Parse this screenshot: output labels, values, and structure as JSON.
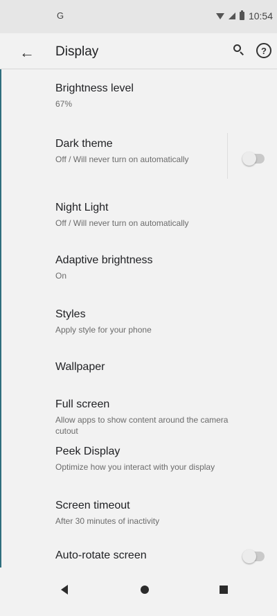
{
  "status_bar": {
    "left_icon": "G",
    "time": "10:54"
  },
  "toolbar": {
    "title": "Display",
    "back_icon": "←",
    "help_icon": "?"
  },
  "items": [
    {
      "title": "Brightness level",
      "subtitle": "67%"
    },
    {
      "title": "Dark theme",
      "subtitle": "Off / Will never turn on automatically",
      "toggle": false
    },
    {
      "title": "Night Light",
      "subtitle": "Off / Will never turn on automatically"
    },
    {
      "title": "Adaptive brightness",
      "subtitle": "On"
    },
    {
      "title": "Styles",
      "subtitle": "Apply style for your phone"
    },
    {
      "title": "Wallpaper"
    },
    {
      "title": "Full screen",
      "subtitle": "Allow apps to show content around the camera cutout"
    },
    {
      "title": "Peek Display",
      "subtitle": "Optimize how you interact with your display"
    },
    {
      "title": "Screen timeout",
      "subtitle": "After 30 minutes of inactivity"
    },
    {
      "title": "Auto-rotate screen",
      "toggle": false
    }
  ],
  "nav": {
    "back": "back",
    "home": "home",
    "recents": "recents"
  },
  "colors": {
    "background": "#f2f2f2",
    "status_bar": "#e6e6e6",
    "toggle_off": "#c9c9c9"
  }
}
